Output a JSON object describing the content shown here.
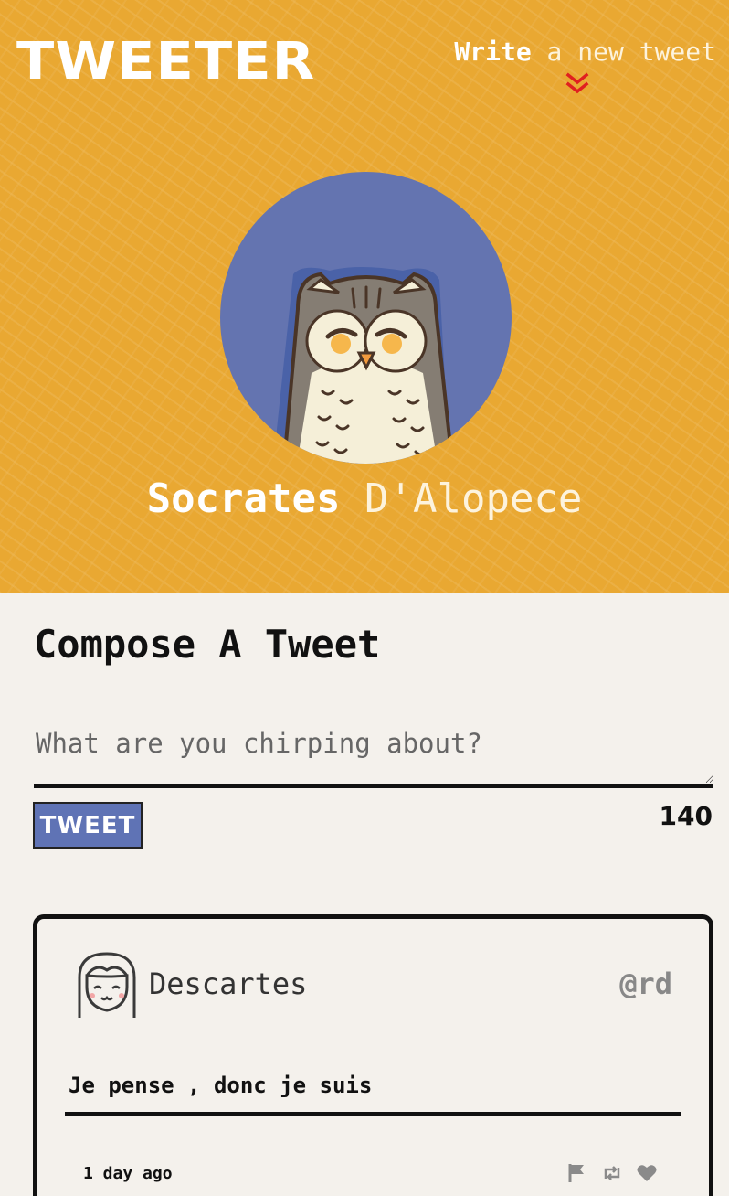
{
  "header": {
    "logo": "TWEETER",
    "write_bold": "Write",
    "write_rest": " a new tweet"
  },
  "profile": {
    "first_name": "Socrates",
    "last_name": "D'Alopece"
  },
  "compose": {
    "title": "Compose A Tweet",
    "placeholder": "What are you chirping about?",
    "button_label": "TWEET",
    "counter": "140"
  },
  "tweets": [
    {
      "name": "Descartes",
      "handle": "@rd",
      "text": "Je pense , donc je suis",
      "time": "1 day ago"
    }
  ],
  "colors": {
    "header_bg": "#e9a832",
    "avatar_bg": "#6474b0",
    "button_bg": "#5f73b5",
    "page_bg": "#f4f1ec",
    "chevron": "#e02020"
  },
  "icons": {
    "chevron": "double-chevron-down-icon",
    "flag": "flag-icon",
    "retweet": "retweet-icon",
    "like": "heart-icon"
  }
}
